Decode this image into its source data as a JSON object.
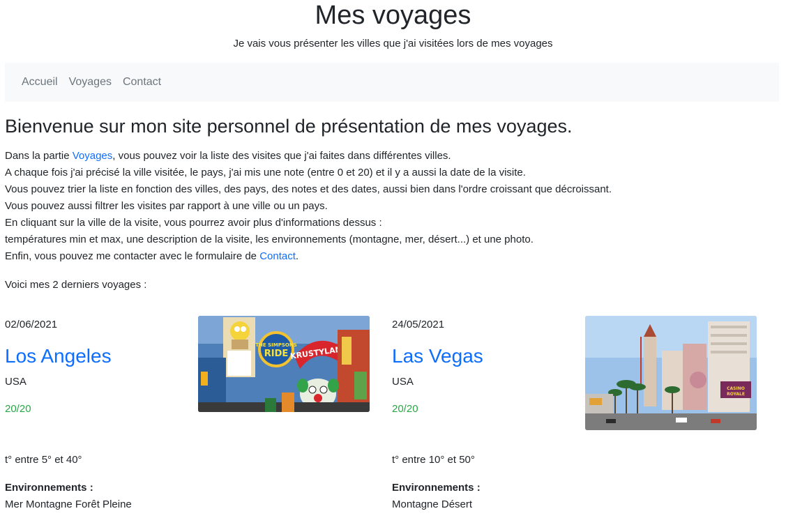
{
  "header": {
    "title": "Mes voyages",
    "subtitle": "Je vais vous présenter les villes que j'ai visitées lors de mes voyages"
  },
  "nav": {
    "items": [
      "Accueil",
      "Voyages",
      "Contact"
    ]
  },
  "main": {
    "heading": "Bienvenue sur mon site personnel de présentation de mes voyages.",
    "intro": {
      "line1_before": "Dans la partie ",
      "line1_link": "Voyages",
      "line1_after": ", vous pouvez voir la liste des visites que j'ai faites dans différentes villes.",
      "line2": "A chaque fois j'ai précisé la ville visitée, le pays, j'ai mis une note (entre 0 et 20) et il y a aussi la date de la visite.",
      "line3": "Vous pouvez trier la liste en fonction des villes, des pays, des notes et des dates, aussi bien dans l'ordre croissant que décroissant.",
      "line4": "Vous pouvez aussi filtrer les visites par rapport à une ville ou un pays.",
      "line5": "En cliquant sur la ville de la visite, vous pourrez avoir plus d'informations dessus :",
      "line6": "températures min et max, une description de la visite, les environnements (montagne, mer, désert...) et une photo.",
      "line7_before": "Enfin, vous pouvez me contacter avec le formulaire de ",
      "line7_link": "Contact",
      "line7_after": "."
    },
    "recent_label": "Voici mes 2 derniers voyages :",
    "trips": [
      {
        "date": "02/06/2021",
        "city": "Los Angeles",
        "country": "USA",
        "note": "20/20",
        "temperature": "t° entre 5° et 40°",
        "env_label": "Environnements :",
        "environments": "Mer Montagne Forêt Pleine",
        "photo_text_1": "THE SIMPSONS RIDE",
        "photo_text_2": "KRUSTYLAND"
      },
      {
        "date": "24/05/2021",
        "city": "Las Vegas",
        "country": "USA",
        "note": "20/20",
        "temperature": "t° entre 10° et 50°",
        "env_label": "Environnements :",
        "environments": "Montagne Désert",
        "photo_text_1": "CASINO ROYALE"
      }
    ]
  },
  "colors": {
    "link": "#0d6efd",
    "note": "#28a745",
    "nav_bg": "#f8f9fa",
    "nav_text": "#6c757d"
  }
}
